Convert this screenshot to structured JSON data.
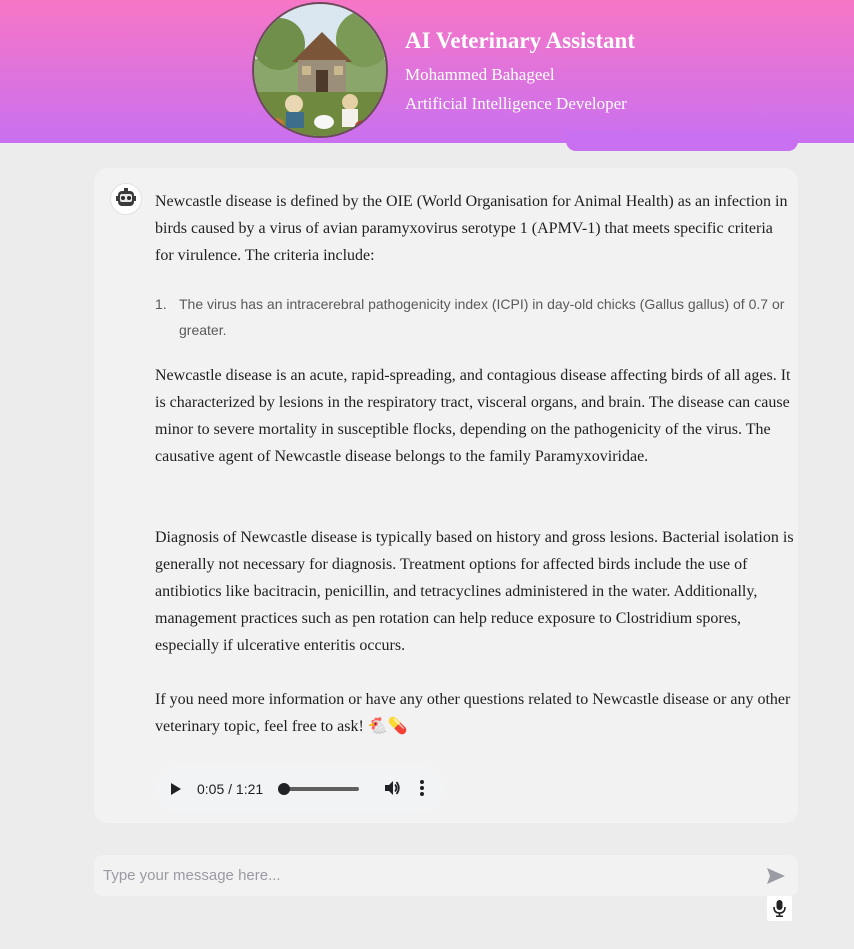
{
  "header": {
    "title": "AI Veterinary Assistant",
    "name": "Mohammed Bahageel",
    "role": "Artificial Intelligence Developer"
  },
  "message": {
    "paragraph1": "Newcastle disease is defined by the OIE (World Organisation for Animal Health) as an infection in birds caused by a virus of avian paramyxovirus serotype 1 (APMV-1) that meets specific criteria for virulence. The criteria include:",
    "list": [
      {
        "number": "1.",
        "text": "The virus has an intracerebral pathogenicity index (ICPI) in day-old chicks (Gallus gallus) of 0.7 or greater."
      }
    ],
    "paragraph2": "Newcastle disease is an acute, rapid-spreading, and contagious disease affecting birds of all ages. It is characterized by lesions in the respiratory tract, visceral organs, and brain. The disease can cause minor to severe mortality in susceptible flocks, depending on the pathogenicity of the virus. The causative agent of Newcastle disease belongs to the family Paramyxoviridae.",
    "paragraph3": "Diagnosis of Newcastle disease is typically based on history and gross lesions. Bacterial isolation is generally not necessary for diagnosis. Treatment options for affected birds include the use of antibiotics like bacitracin, penicillin, and tetracyclines administered in the water. Additionally, management practices such as pen rotation can help reduce exposure to Clostridium spores, especially if ulcerative enteritis occurs.",
    "paragraph4": "If you need more information or have any other questions related to Newcastle disease or any other veterinary topic, feel free to ask! 🐔💊"
  },
  "audio": {
    "time": "0:05 / 1:21",
    "progress": 0.06
  },
  "chat_input": {
    "placeholder": "Type your message here...",
    "value": ""
  },
  "icons": {
    "avatar": "farm-scene-image",
    "bot": "robot-face-icon",
    "play": "play-icon",
    "volume": "volume-icon",
    "more": "more-vertical-icon",
    "send": "send-icon",
    "mic": "microphone-icon"
  },
  "colors": {
    "header_top": "#f776c6",
    "header_bottom": "#c970f0",
    "background": "#ececec",
    "card": "#f2f2f2"
  }
}
